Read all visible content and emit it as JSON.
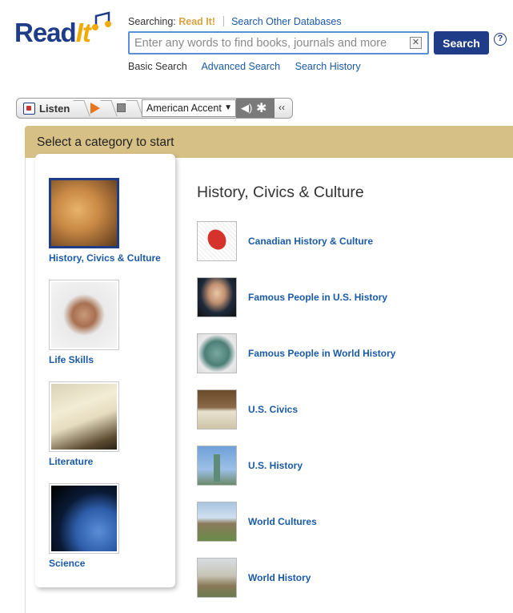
{
  "brand": {
    "name": "Read",
    "name_accent": "It"
  },
  "search": {
    "searching_prefix": "Searching:",
    "current_db": "Read It!",
    "other_db_link": "Search Other Databases",
    "placeholder": "Enter any words to find books, journals and more",
    "value": "",
    "button_label": "Search",
    "help_label": "?",
    "links": {
      "basic": "Basic Search",
      "advanced": "Advanced Search",
      "history": "Search History"
    }
  },
  "toolbar": {
    "listen_label": "Listen",
    "accent_selected": "American Accent",
    "collapse_label": "‹‹"
  },
  "panel": {
    "header": "Select a category to start",
    "categories": [
      {
        "label": "History, Civics & Culture",
        "selected": true,
        "icon": "pharaoh-statue-image"
      },
      {
        "label": "Life Skills",
        "selected": false,
        "icon": "handshake-image"
      },
      {
        "label": "Literature",
        "selected": false,
        "icon": "open-book-image"
      },
      {
        "label": "Science",
        "selected": false,
        "icon": "earth-image"
      }
    ]
  },
  "topics": {
    "title": "History, Civics & Culture",
    "items": [
      {
        "label": "Canadian History & Culture",
        "icon": "canada-stamp-image"
      },
      {
        "label": "Famous People in U.S. History",
        "icon": "president-portrait-image"
      },
      {
        "label": "Famous People in World History",
        "icon": "mandela-stamp-image"
      },
      {
        "label": "U.S. Civics",
        "icon": "gavel-book-image"
      },
      {
        "label": "U.S. History",
        "icon": "statue-of-liberty-image"
      },
      {
        "label": "World Cultures",
        "icon": "pyramid-image"
      },
      {
        "label": "World History",
        "icon": "great-wall-image"
      }
    ]
  },
  "colors": {
    "brand_blue": "#1f3c88",
    "brand_gold": "#f2a900",
    "link_blue": "#1a5aa6",
    "panel_header": "#d7c085",
    "play_orange": "#e8761a"
  }
}
